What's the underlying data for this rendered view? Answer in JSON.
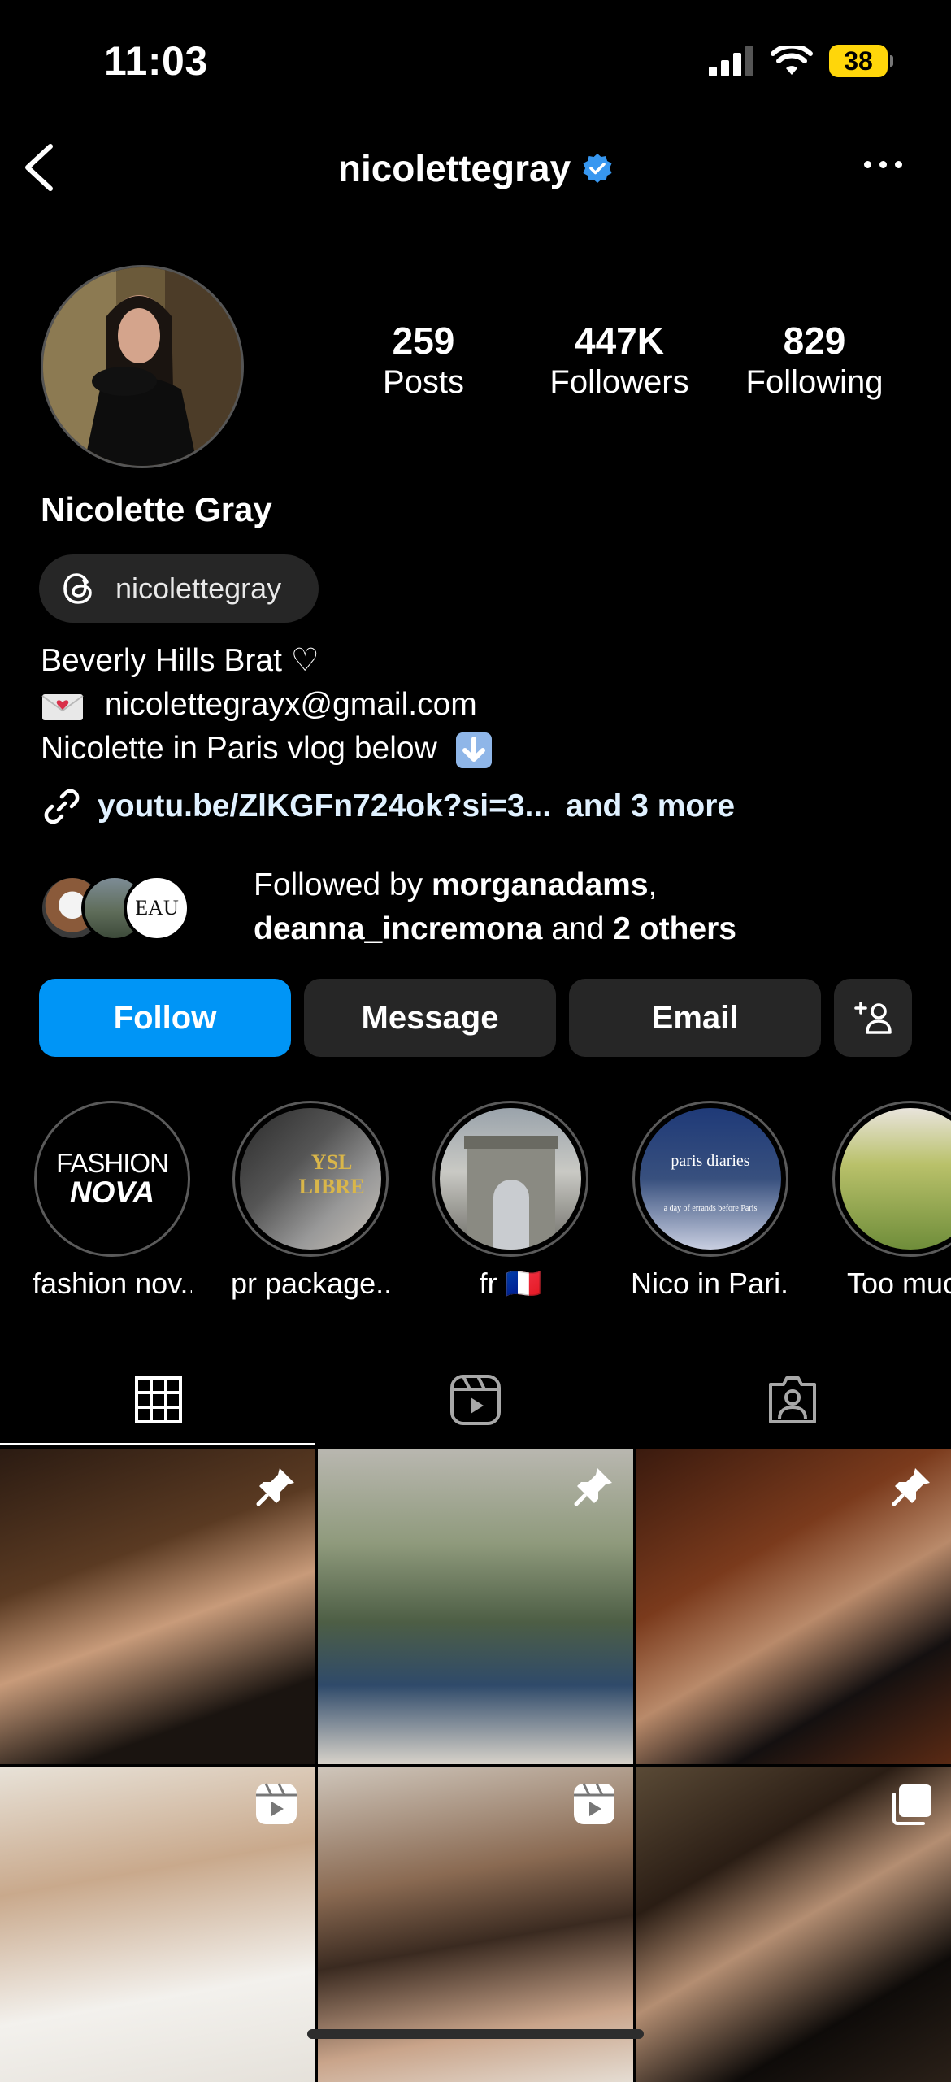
{
  "status": {
    "time": "11:03",
    "battery": "38"
  },
  "header": {
    "username": "nicolettegray"
  },
  "profile": {
    "display_name": "Nicolette Gray",
    "stats": [
      {
        "value": "259",
        "label": "Posts"
      },
      {
        "value": "447K",
        "label": "Followers"
      },
      {
        "value": "829",
        "label": "Following"
      }
    ],
    "threads_handle": "nicolettegray",
    "bio": {
      "line1": "Beverly Hills Brat ♡",
      "line2": "nicolettegrayx@gmail.com",
      "line3": "Nicolette in Paris vlog below"
    },
    "link": {
      "url": "youtu.be/ZlKGFn724ok?si=3...",
      "more": "and 3 more"
    },
    "followed_by": {
      "prefix": "Followed by",
      "user1": "morganadams",
      "user2": "deanna_incremona",
      "and": "and",
      "others": "2 others"
    }
  },
  "actions": {
    "follow": "Follow",
    "message": "Message",
    "email": "Email"
  },
  "highlights": [
    {
      "label": "fashion nov...",
      "cover_text_top": "FASHION",
      "cover_text_bottom": "NOVA"
    },
    {
      "label": "pr package...",
      "cover_text": "YSL LIBRE"
    },
    {
      "label": "fr 🇫🇷"
    },
    {
      "label": "Nico in Pari...",
      "cover_text": "paris diaries",
      "cover_sub": "a day of errands before Paris"
    },
    {
      "label": "Too much"
    }
  ],
  "tabs": [
    "grid",
    "reels",
    "tagged"
  ],
  "colors": {
    "accent": "#0095f6",
    "verified": "#3797f0",
    "button_dark": "#262626",
    "battery": "#ffd60a"
  },
  "grid_icons": [
    "pin-icon",
    "pin-icon",
    "pin-icon",
    "reel-icon",
    "reel-icon",
    "carousel-icon"
  ]
}
